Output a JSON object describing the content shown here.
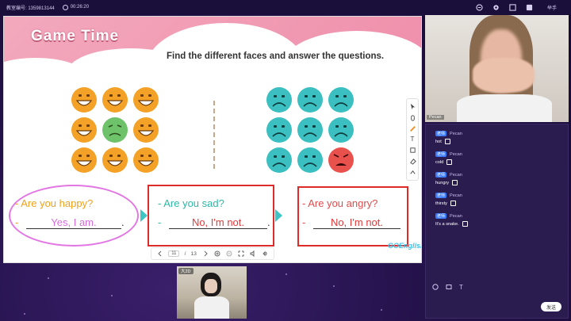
{
  "topbar": {
    "class_no": "教室编号: 1359813144",
    "timer": "00:26:20",
    "raise_hand_label": "举手",
    "icons": [
      "share-icon",
      "gear-icon",
      "fullscreen-icon",
      "toggle-icon"
    ]
  },
  "slide": {
    "title": "Game Time",
    "instruction": "Find the different faces and answer the questions.",
    "happy_group": [
      "happy",
      "happy",
      "happy",
      "happy",
      "sick",
      "happy",
      "happy",
      "happy",
      "happy"
    ],
    "sad_group": [
      "sad",
      "sad",
      "sad",
      "sad",
      "sad",
      "sad",
      "sad",
      "sad",
      "angry"
    ],
    "box1": {
      "question": "- Are you happy?",
      "answer_prefix": "-",
      "answer": "Yes, I am."
    },
    "box2": {
      "question": "- Are you sad?",
      "answer_prefix": "-",
      "answer": "No, I'm not."
    },
    "box3": {
      "question": "- Are you angry?",
      "answer_prefix": "-",
      "answer": "No, I'm not."
    },
    "brand": "GOEnglish",
    "colors": {
      "pink": "#ef8fab",
      "orange_face": "#f4a227",
      "teal_face": "#3bbfc0",
      "green_face": "#6ec36a",
      "red_face": "#e9514c"
    }
  },
  "pager": {
    "current": "11",
    "separator": "/",
    "total": "13"
  },
  "student": {
    "name": "大2D"
  },
  "teacher": {
    "name": "Pecan"
  },
  "chat": {
    "messages": [
      {
        "badge": "老师",
        "sender": "Pecan",
        "text": "hot"
      },
      {
        "badge": "老师",
        "sender": "Pecan",
        "text": "cold"
      },
      {
        "badge": "老师",
        "sender": "Pecan",
        "text": "hungry"
      },
      {
        "badge": "老师",
        "sender": "Pecan",
        "text": "thirsty"
      },
      {
        "badge": "老师",
        "sender": "Pecan",
        "text": "It's a snake."
      }
    ],
    "send_label": "发送"
  }
}
